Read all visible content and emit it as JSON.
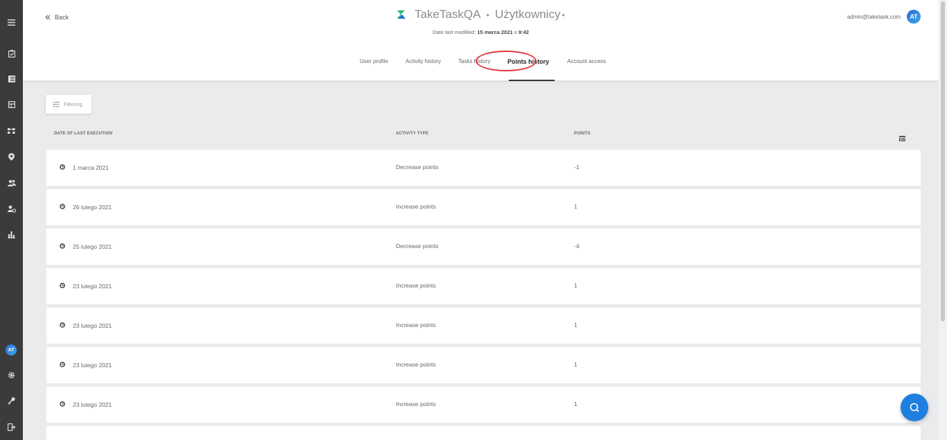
{
  "app": {
    "name": "TakeTaskQA",
    "separator": "•",
    "section": "Użytkownicy",
    "section_suffix": "•"
  },
  "header": {
    "back_label": "Back",
    "modified_prefix": "Date last modified:",
    "modified_date": "15 marca 2021",
    "modified_conj": "o",
    "modified_time": "9:42",
    "email": "admin@taketask.com",
    "avatar_initials": "AT"
  },
  "tabs": [
    {
      "label": "User profile"
    },
    {
      "label": "Activity history"
    },
    {
      "label": "Tasks history"
    },
    {
      "label": "Points history",
      "active": true
    },
    {
      "label": "Account access"
    }
  ],
  "filter": {
    "label": "Filtering"
  },
  "table": {
    "columns": [
      "DATE OF LAST EXECUTION",
      "ACTIVITY TYPE",
      "POINTS"
    ],
    "rows": [
      {
        "date": "1 marca 2021",
        "type": "Decrease points",
        "points": "-1"
      },
      {
        "date": "26 lutego 2021",
        "type": "Increase points",
        "points": "1"
      },
      {
        "date": "25 lutego 2021",
        "type": "Decrease points",
        "points": "-4"
      },
      {
        "date": "23 lutego 2021",
        "type": "Increase points",
        "points": "1"
      },
      {
        "date": "23 lutego 2021",
        "type": "Increase points",
        "points": "1"
      },
      {
        "date": "23 lutego 2021",
        "type": "Increase points",
        "points": "1"
      },
      {
        "date": "23 lutego 2021",
        "type": "Increase points",
        "points": "1"
      }
    ]
  },
  "sidebar": {
    "icons": [
      "menu-icon",
      "tasks-icon",
      "list-icon",
      "layout-icon",
      "workflow-icon",
      "location-icon",
      "users-icon",
      "user-settings-icon",
      "reports-icon"
    ],
    "bottom_icons": [
      "settings-icon",
      "key-icon",
      "logout-icon"
    ],
    "avatar_initials": "AT"
  },
  "colors": {
    "accent": "#1f7ee0",
    "highlight_ring": "#e0373d",
    "rail": "#3a3b3d",
    "background": "#eaebec",
    "logo_green": "#2bb673",
    "logo_blue": "#1e6fd9"
  }
}
